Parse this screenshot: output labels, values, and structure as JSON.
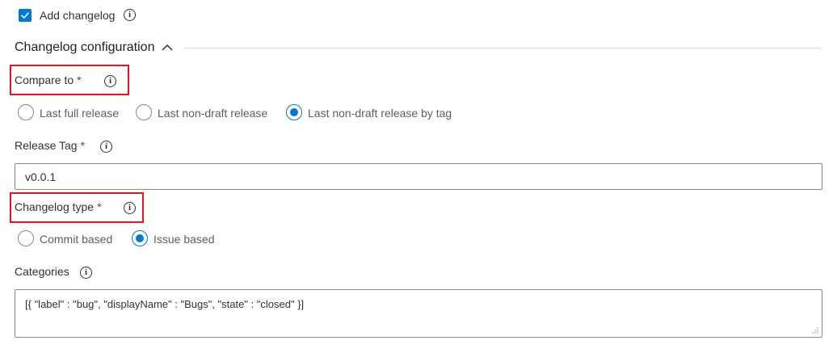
{
  "add_changelog": {
    "label": "Add changelog",
    "checked": true
  },
  "section": {
    "title": "Changelog configuration",
    "expanded": true
  },
  "compare_to": {
    "label": "Compare to",
    "required_mark": "*",
    "options": [
      {
        "label": "Last full release",
        "selected": false
      },
      {
        "label": "Last non-draft release",
        "selected": false
      },
      {
        "label": "Last non-draft release by tag",
        "selected": true
      }
    ]
  },
  "release_tag": {
    "label": "Release Tag",
    "required_mark": "*",
    "value": "v0.0.1"
  },
  "changelog_type": {
    "label": "Changelog type",
    "required_mark": "*",
    "options": [
      {
        "label": "Commit based",
        "selected": false
      },
      {
        "label": "Issue based",
        "selected": true
      }
    ]
  },
  "categories": {
    "label": "Categories",
    "value": "[{ \"label\" : \"bug\", \"displayName\" : \"Bugs\", \"state\" : \"closed\" }]"
  },
  "colors": {
    "accent": "#0078d4",
    "highlight": "#e81123",
    "required": "#a4262c"
  }
}
